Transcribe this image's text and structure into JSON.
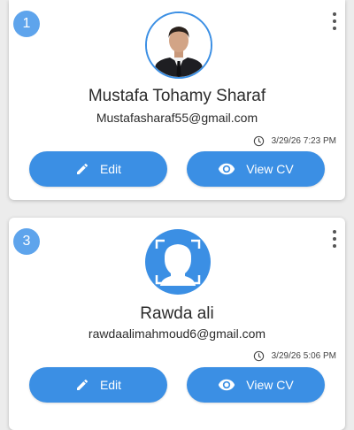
{
  "cards": [
    {
      "number": "1",
      "name": "Mustafa Tohamy Sharaf",
      "email": "Mustafasharaf55@gmail.com",
      "timestamp": "3/29/26 7:23 PM",
      "avatar": "profile-photo",
      "edit_label": "Edit",
      "view_label": "View CV"
    },
    {
      "number": "3",
      "name": "Rawda ali",
      "email": "rawdaalimahmoud6@gmail.com",
      "timestamp": "3/29/26 5:06 PM",
      "avatar": "default-person-icon",
      "edit_label": "Edit",
      "view_label": "View CV"
    }
  ],
  "icons": {
    "menu": "more-vert-icon",
    "time": "clock-icon",
    "edit": "pencil-icon",
    "view": "eye-icon"
  },
  "colors": {
    "accent": "#3b8fe4",
    "badge": "#5ea4ec",
    "background": "#ececec",
    "card": "#ffffff"
  }
}
